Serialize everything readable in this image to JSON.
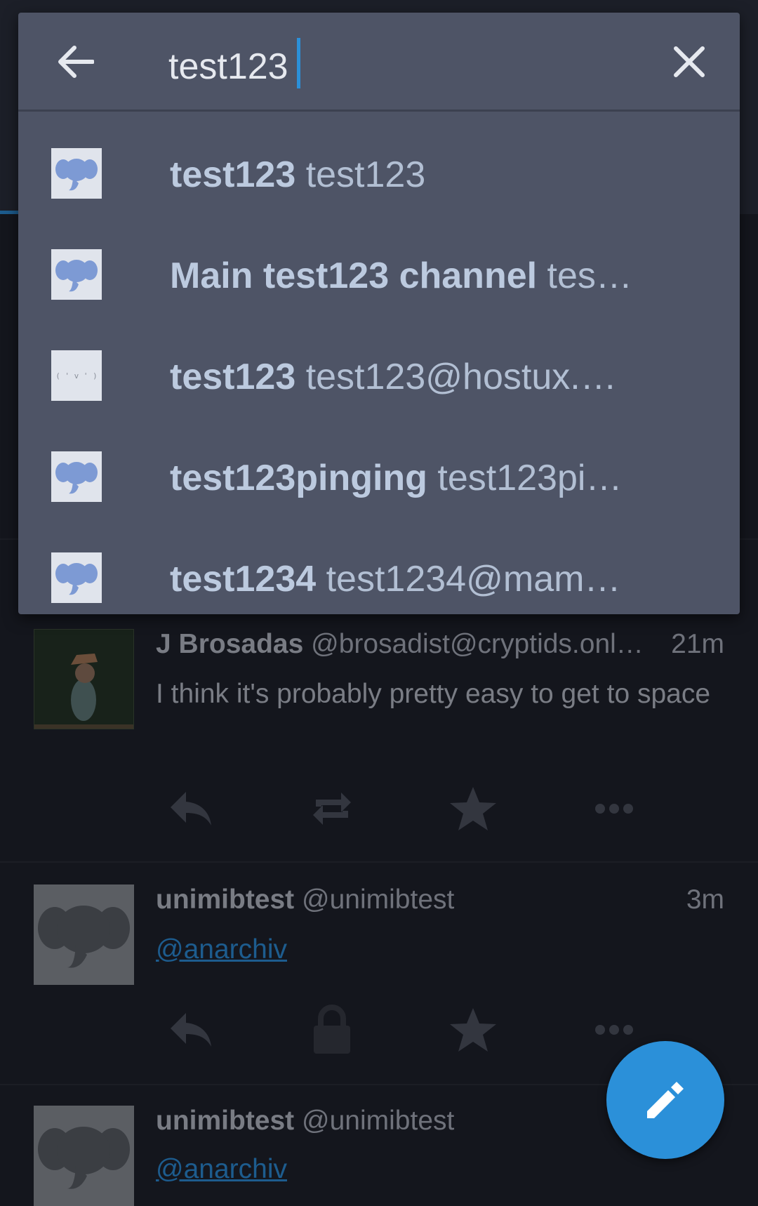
{
  "search": {
    "query": "test123",
    "results": [
      {
        "name": "test123",
        "handle": "test123",
        "avatar": "elephant-icon"
      },
      {
        "name": "Main test123 channel",
        "handle": "tes…",
        "avatar": "elephant-icon"
      },
      {
        "name": "test123",
        "handle": "test123@hostux.…",
        "avatar": "ascii-face",
        "avatar_text": "( ' v ' )"
      },
      {
        "name": "test123pinging",
        "handle": "test123pi…",
        "avatar": "elephant-icon"
      },
      {
        "name": "test1234",
        "handle": "test1234@mam…",
        "avatar": "elephant-icon"
      }
    ]
  },
  "timeline": [
    {
      "name": "J Brosadas",
      "handle": "@brosadist@cryptids.onl…",
      "time": "21m",
      "body": "I think it's probably pretty easy to get to space",
      "avatar": "photo-avatar",
      "actions": [
        "reply-icon",
        "boost-icon",
        "star-icon",
        "more-icon"
      ]
    },
    {
      "name": "unimibtest",
      "handle": "@unimibtest",
      "time": "3m",
      "link": "@anarchiv",
      "avatar": "elephant-icon",
      "actions": [
        "reply-icon",
        "lock-icon",
        "star-icon",
        "more-icon"
      ]
    },
    {
      "name": "unimibtest",
      "handle": "@unimibtest",
      "time": "",
      "link": "@anarchiv",
      "avatar": "elephant-icon"
    }
  ],
  "colors": {
    "accent": "#2b90d9",
    "overlay": "#4e5466",
    "background": "#14161d"
  }
}
